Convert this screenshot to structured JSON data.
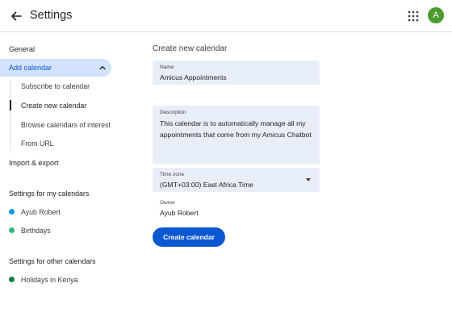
{
  "header": {
    "title": "Settings",
    "avatar_letter": "A",
    "avatar_color": "#4c9b2e"
  },
  "sidebar": {
    "general": "General",
    "add_calendar": "Add calendar",
    "sub_items": [
      "Subscribe to calendar",
      "Create new calendar",
      "Browse calendars of interest",
      "From URL"
    ],
    "import_export": "Import & export",
    "my_calendars_heading": "Settings for my calendars",
    "my_calendars": [
      {
        "label": "Ayub Robert",
        "color": "#039be5"
      },
      {
        "label": "Birthdays",
        "color": "#33b679"
      }
    ],
    "other_calendars_heading": "Settings for other calendars",
    "other_calendars": [
      {
        "label": "Holidays in Kenya",
        "color": "#0b8043"
      }
    ]
  },
  "form": {
    "heading": "Create new calendar",
    "name_label": "Name",
    "name_value": "Amicus Appointments",
    "description_label": "Description",
    "description_value": "This calendar is to automatically manage all my appointments that come from my Amicus Chatbot",
    "timezone_label": "Time zone",
    "timezone_value": "(GMT+03:00) East Africa Time",
    "owner_label": "Owner",
    "owner_value": "Ayub Robert",
    "submit_label": "Create calendar"
  },
  "colors": {
    "accent": "#0b57d0",
    "active_bg": "#d3e3fd",
    "field_bg": "#e8eef8"
  }
}
